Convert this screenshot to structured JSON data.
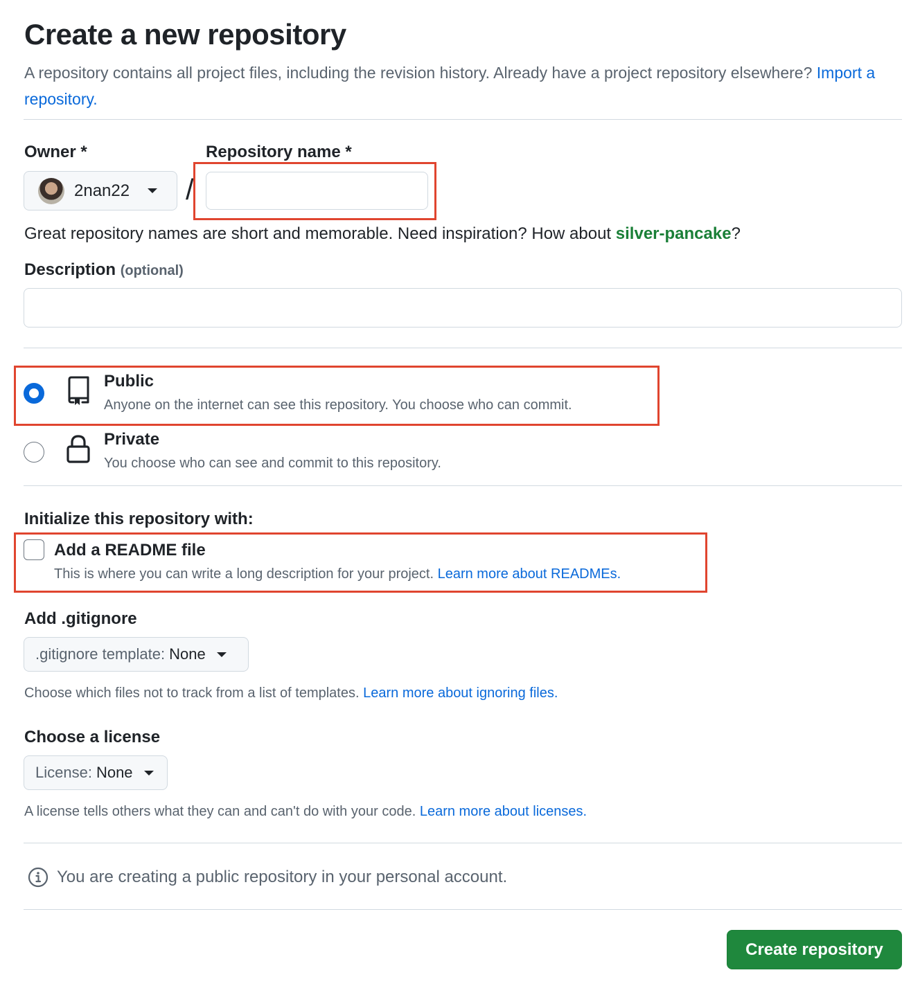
{
  "header": {
    "title": "Create a new repository",
    "intro_text": "A repository contains all project files, including the revision history. Already have a project repository elsewhere?",
    "import_link": "Import a repository."
  },
  "owner": {
    "label": "Owner *",
    "value": "2nan22",
    "avatar_icon": "user-avatar"
  },
  "separator": "/",
  "repo_name": {
    "label": "Repository name *",
    "value": "",
    "hint_prefix": "Great repository names are short and memorable. Need inspiration? How about ",
    "suggestion": "silver-pancake",
    "hint_suffix": "?"
  },
  "description": {
    "label": "Description",
    "optional": "(optional)",
    "value": ""
  },
  "visibility": {
    "selected": "public",
    "options": [
      {
        "key": "public",
        "title": "Public",
        "desc": "Anyone on the internet can see this repository. You choose who can commit.",
        "icon": "repo-icon"
      },
      {
        "key": "private",
        "title": "Private",
        "desc": "You choose who can see and commit to this repository.",
        "icon": "lock-icon"
      }
    ]
  },
  "init": {
    "label": "Initialize this repository with:",
    "readme": {
      "title": "Add a README file",
      "checked": false,
      "desc": "This is where you can write a long description for your project.",
      "link": "Learn more about READMEs."
    }
  },
  "gitignore": {
    "label": "Add .gitignore",
    "prefix": ".gitignore template:",
    "value": "None",
    "note": "Choose which files not to track from a list of templates.",
    "link": "Learn more about ignoring files."
  },
  "license": {
    "label": "Choose a license",
    "prefix": "License:",
    "value": "None",
    "note": "A license tells others what they can and can't do with your code.",
    "link": "Learn more about licenses."
  },
  "info_message": "You are creating a public repository in your personal account.",
  "submit_label": "Create repository",
  "colors": {
    "accent": "#0969da",
    "primary_button": "#1f883d",
    "suggestion": "#1a7f37",
    "highlight": "#e0452f"
  }
}
